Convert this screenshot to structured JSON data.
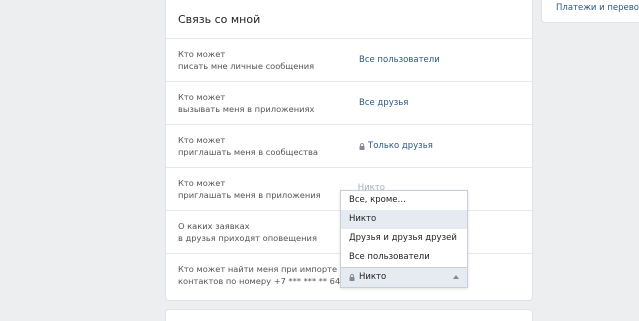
{
  "right_panel": {
    "link": "Платежи и переводы"
  },
  "card": {
    "title": "Связь со мной",
    "rows": [
      {
        "label_1": "Кто может",
        "label_2": "писать мне личные сообщения",
        "value": "Все пользователи",
        "lock": false
      },
      {
        "label_1": "Кто может",
        "label_2": "вызывать меня в приложениях",
        "value": "Все друзья",
        "lock": false
      },
      {
        "label_1": "Кто может",
        "label_2": "приглашать меня в сообщества",
        "value": "Только друзья",
        "lock": true
      },
      {
        "label_1": "Кто может",
        "label_2": "приглашать меня в приложения",
        "value": "Никто",
        "lock": true
      },
      {
        "label_1": "О каких заявках",
        "label_2": "в друзья приходят оповещения",
        "value": "",
        "lock": false
      },
      {
        "label_1": "Кто может найти меня при импорте",
        "label_2": "контактов по номеру +7 *** *** ** 64",
        "value": "",
        "lock": false
      }
    ]
  },
  "dropdown": {
    "options": [
      "Все, кроме…",
      "Никто",
      "Друзья и друзья друзей",
      "Все пользователи"
    ],
    "selected_index": 1,
    "current": "Никто"
  },
  "colors": {
    "link": "#2a5885",
    "background": "#edeef0",
    "hover": "#e5ebf1"
  }
}
